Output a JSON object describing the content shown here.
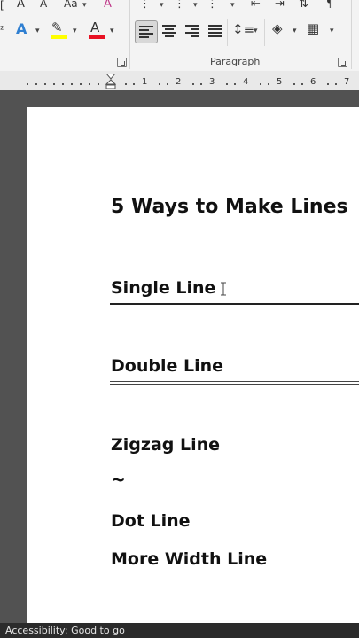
{
  "ribbon": {
    "paragraph_group_label": "Paragraph"
  },
  "ruler": {
    "numbers": [
      "1",
      "2",
      "3",
      "4",
      "5",
      "6",
      "7"
    ]
  },
  "document": {
    "title": "5 Ways to Make Lines",
    "single_line": "Single Line",
    "double_line": "Double Line",
    "zigzag_line": "Zigzag Line",
    "zigzag_char": "~",
    "dot_line": "Dot Line",
    "more_width_line": "More Width Line"
  },
  "status_bar": {
    "accessibility": "Accessibility: Good to go"
  },
  "colors": {
    "highlight": "#ffff00",
    "font_color": "#e81123",
    "text_effects": "#2f7fd1"
  }
}
